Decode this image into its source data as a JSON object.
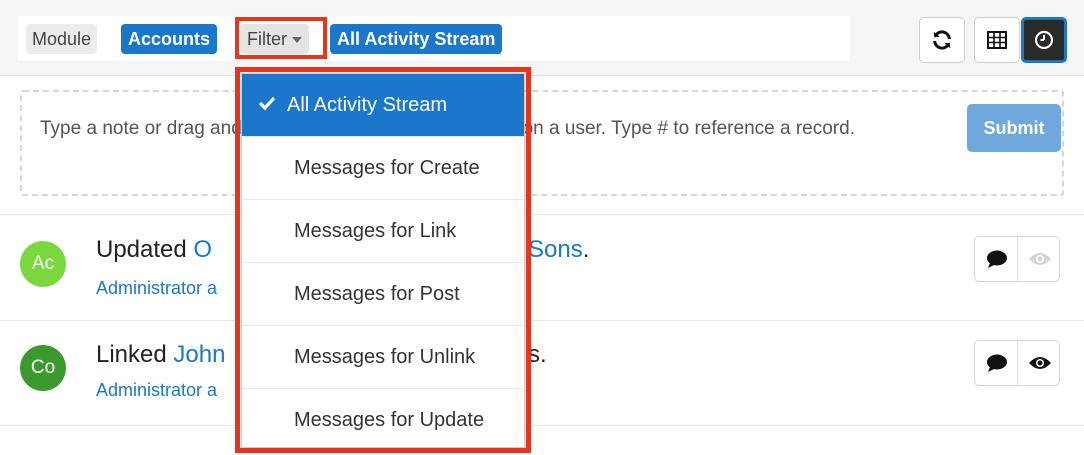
{
  "toolbar": {
    "module_label": "Module",
    "module_value": "Accounts",
    "filter_label": "Filter",
    "filter_value": "All Activity Stream",
    "buttons": [
      "refresh-icon",
      "table-icon",
      "clock-icon"
    ],
    "active_button": "clock-icon"
  },
  "composer": {
    "placeholder": "Type a note or drag and drop a file here. Type @ to mention a user. Type # to reference a record.",
    "submit_label": "Submit"
  },
  "activities": [
    {
      "avatar_initials": "Ac",
      "avatar_color": "#7ad83e",
      "action": "Updated",
      "link_visible": "O",
      "link_tail": "Sons",
      "suffix": ".",
      "subline_visible": "Administrator a",
      "view_active": false
    },
    {
      "avatar_initials": "Co",
      "avatar_color": "#3a9a2c",
      "action": "Linked",
      "link_visible": "John",
      "link_tail": "",
      "suffix": "s.",
      "subline_visible": "Administrator a",
      "view_active": true
    }
  ],
  "dropdown": {
    "items": [
      {
        "label": "All Activity Stream",
        "selected": true
      },
      {
        "label": "Messages for Create",
        "selected": false
      },
      {
        "label": "Messages for Link",
        "selected": false
      },
      {
        "label": "Messages for Post",
        "selected": false
      },
      {
        "label": "Messages for Unlink",
        "selected": false
      },
      {
        "label": "Messages for Update",
        "selected": false
      }
    ]
  },
  "colors": {
    "accent": "#1a77c9",
    "highlight": "#e8341c",
    "submit": "#6fa8dc"
  }
}
